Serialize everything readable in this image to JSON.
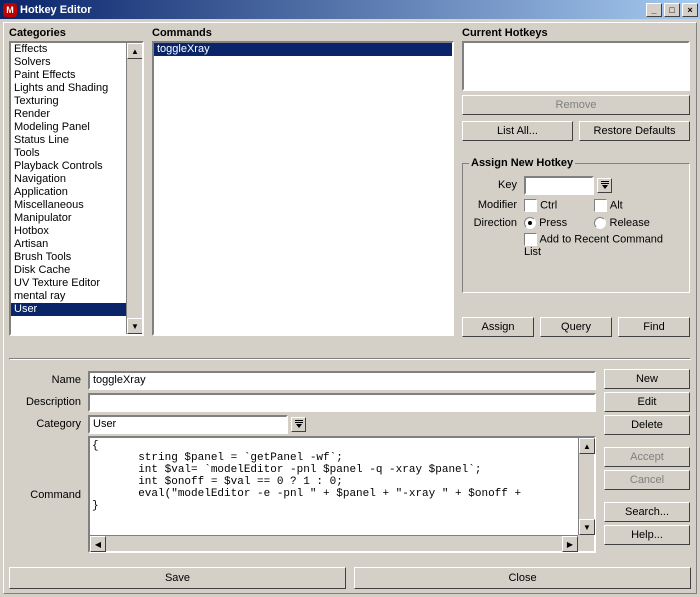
{
  "window": {
    "title": "Hotkey Editor",
    "icon_letter": "M"
  },
  "categories": {
    "heading": "Categories",
    "items": [
      "Effects",
      "Solvers",
      "Paint Effects",
      "Lights and Shading",
      "Texturing",
      "Render",
      "Modeling Panel",
      "Status Line",
      "Tools",
      "Playback Controls",
      "Navigation",
      "Application",
      "Miscellaneous",
      "Manipulator",
      "Hotbox",
      "Artisan",
      "Brush Tools",
      "Disk Cache",
      "UV Texture Editor",
      "mental ray",
      "User"
    ],
    "selected": "User"
  },
  "commands": {
    "heading": "Commands",
    "items": [
      "toggleXray"
    ],
    "selected": "toggleXray"
  },
  "current_hotkeys": {
    "heading": "Current Hotkeys",
    "remove_label": "Remove",
    "list_all_label": "List All...",
    "restore_defaults_label": "Restore Defaults"
  },
  "assign": {
    "heading": "Assign New Hotkey",
    "key_label": "Key",
    "key_value": "",
    "modifier_label": "Modifier",
    "ctrl_label": "Ctrl",
    "alt_label": "Alt",
    "direction_label": "Direction",
    "press_label": "Press",
    "release_label": "Release",
    "direction_value": "press",
    "add_recent_label": "Add to Recent Command List",
    "assign_label": "Assign",
    "query_label": "Query",
    "find_label": "Find"
  },
  "editor": {
    "name_label": "Name",
    "name_value": "toggleXray",
    "description_label": "Description",
    "description_value": "",
    "category_label": "Category",
    "category_value": "User",
    "command_label": "Command",
    "command_text": "{\n       string $panel = `getPanel -wf`;\n       int $val= `modelEditor -pnl $panel -q -xray $panel`;\n       int $onoff = $val == 0 ? 1 : 0;\n       eval(\"modelEditor -e -pnl \" + $panel + \"-xray \" + $onoff +\n}"
  },
  "buttons": {
    "new": "New",
    "edit": "Edit",
    "delete": "Delete",
    "accept": "Accept",
    "cancel": "Cancel",
    "search": "Search...",
    "help": "Help...",
    "save": "Save",
    "close": "Close"
  }
}
